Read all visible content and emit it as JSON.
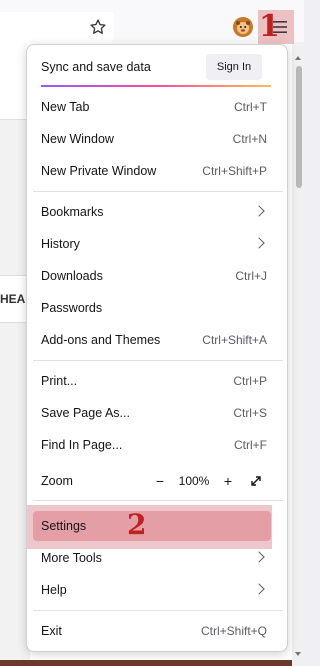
{
  "menu": {
    "sync_label": "Sync and save data",
    "sign_in_label": "Sign In",
    "items": [
      {
        "label": "New Tab",
        "shortcut": "Ctrl+T"
      },
      {
        "label": "New Window",
        "shortcut": "Ctrl+N"
      },
      {
        "label": "New Private Window",
        "shortcut": "Ctrl+Shift+P"
      },
      {
        "label": "Bookmarks",
        "shortcut": ""
      },
      {
        "label": "History",
        "shortcut": ""
      },
      {
        "label": "Downloads",
        "shortcut": "Ctrl+J"
      },
      {
        "label": "Passwords",
        "shortcut": ""
      },
      {
        "label": "Add-ons and Themes",
        "shortcut": "Ctrl+Shift+A"
      },
      {
        "label": "Print...",
        "shortcut": "Ctrl+P"
      },
      {
        "label": "Save Page As...",
        "shortcut": "Ctrl+S"
      },
      {
        "label": "Find In Page...",
        "shortcut": "Ctrl+F"
      },
      {
        "label": "Zoom",
        "shortcut": ""
      },
      {
        "label": "Settings",
        "shortcut": ""
      },
      {
        "label": "More Tools",
        "shortcut": ""
      },
      {
        "label": "Help",
        "shortcut": ""
      },
      {
        "label": "Exit",
        "shortcut": "Ctrl+Shift+Q"
      }
    ],
    "zoom": {
      "minus": "−",
      "value": "100%",
      "plus": "+"
    }
  },
  "annotations": {
    "marker_1": "1",
    "marker_2": "2"
  },
  "page": {
    "partial_heading": "HEA"
  },
  "colors": {
    "highlight": "#d5828c",
    "marker": "#c0201f",
    "accent_gradient_start": "#9059ff",
    "accent_gradient_mid": "#ff4aa2",
    "accent_gradient_end": "#ffbd4f"
  },
  "icons": {
    "star": "bookmark-star-icon",
    "extension": "extension-icon",
    "menu": "hamburger-menu-icon",
    "fullscreen": "fullscreen-icon"
  }
}
